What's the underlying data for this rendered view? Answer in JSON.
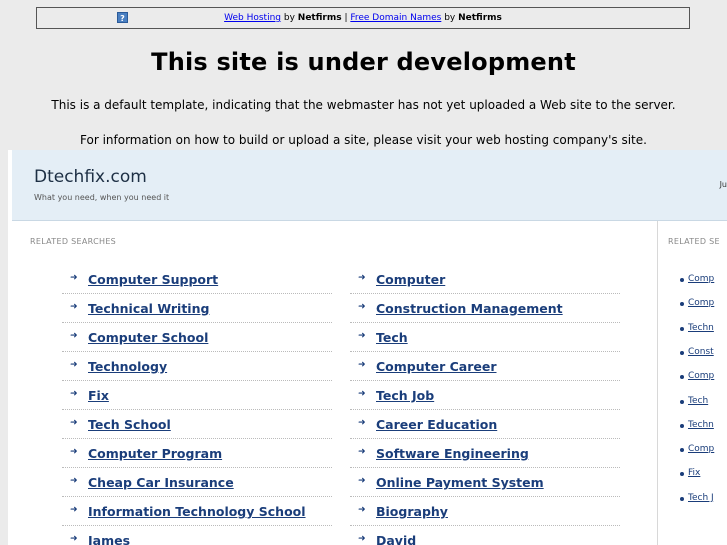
{
  "banner": {
    "link1": "Web Hosting",
    "by1": " by ",
    "brand1": "Netfirms",
    "sep": " | ",
    "link2": "Free Domain Names",
    "by2": " by ",
    "brand2": "Netfirms",
    "icon": "question-icon"
  },
  "title": "This site is under development",
  "message1": "This is a default template, indicating that the webmaster has not yet uploaded a Web site to the server.",
  "message2": "For information on how to build or upload a site, please visit your web hosting company's site.",
  "parked": {
    "site_title": "Dtechfix.com",
    "tagline": "What you need, when you need it",
    "header_right": "Ju",
    "related_label": "RELATED SEARCHES",
    "left_column": [
      "Computer Support",
      "Technical Writing",
      "Computer School",
      "Technology",
      "Fix",
      "Tech School",
      "Computer Program",
      "Cheap Car Insurance",
      "Information Technology School",
      "James"
    ],
    "right_column": [
      "Computer",
      "Construction Management",
      "Tech",
      "Computer Career",
      "Tech Job",
      "Career Education",
      "Software Engineering",
      "Online Payment System",
      "Biography",
      "David"
    ],
    "sidebar_label": "RELATED SE",
    "sidebar_items": [
      "Comp",
      "Comp",
      "Techn",
      "Const",
      "Comp",
      "Tech",
      "Techn",
      "Comp",
      "Fix",
      "Tech J"
    ]
  },
  "colors": {
    "link": "#1a3d7a",
    "header_bg": "#e4eef6",
    "page_bg": "#ebebeb"
  }
}
